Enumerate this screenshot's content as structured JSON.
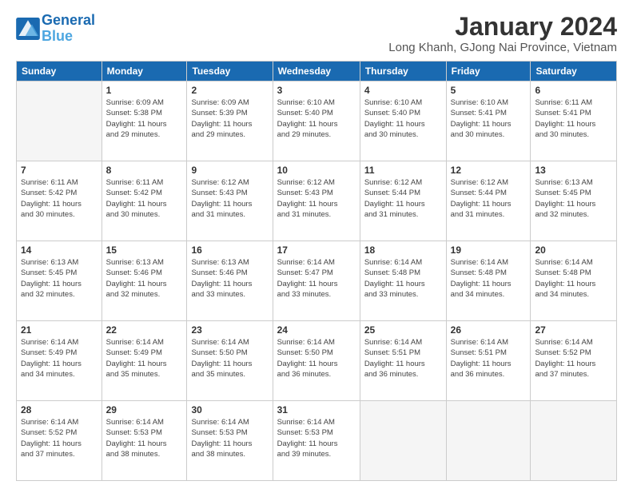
{
  "logo": {
    "line1": "General",
    "line2": "Blue"
  },
  "title": "January 2024",
  "location": "Long Khanh, GJong Nai Province, Vietnam",
  "headers": [
    "Sunday",
    "Monday",
    "Tuesday",
    "Wednesday",
    "Thursday",
    "Friday",
    "Saturday"
  ],
  "weeks": [
    [
      {
        "day": "",
        "info": ""
      },
      {
        "day": "1",
        "info": "Sunrise: 6:09 AM\nSunset: 5:38 PM\nDaylight: 11 hours\nand 29 minutes."
      },
      {
        "day": "2",
        "info": "Sunrise: 6:09 AM\nSunset: 5:39 PM\nDaylight: 11 hours\nand 29 minutes."
      },
      {
        "day": "3",
        "info": "Sunrise: 6:10 AM\nSunset: 5:40 PM\nDaylight: 11 hours\nand 29 minutes."
      },
      {
        "day": "4",
        "info": "Sunrise: 6:10 AM\nSunset: 5:40 PM\nDaylight: 11 hours\nand 30 minutes."
      },
      {
        "day": "5",
        "info": "Sunrise: 6:10 AM\nSunset: 5:41 PM\nDaylight: 11 hours\nand 30 minutes."
      },
      {
        "day": "6",
        "info": "Sunrise: 6:11 AM\nSunset: 5:41 PM\nDaylight: 11 hours\nand 30 minutes."
      }
    ],
    [
      {
        "day": "7",
        "info": "Sunrise: 6:11 AM\nSunset: 5:42 PM\nDaylight: 11 hours\nand 30 minutes."
      },
      {
        "day": "8",
        "info": "Sunrise: 6:11 AM\nSunset: 5:42 PM\nDaylight: 11 hours\nand 30 minutes."
      },
      {
        "day": "9",
        "info": "Sunrise: 6:12 AM\nSunset: 5:43 PM\nDaylight: 11 hours\nand 31 minutes."
      },
      {
        "day": "10",
        "info": "Sunrise: 6:12 AM\nSunset: 5:43 PM\nDaylight: 11 hours\nand 31 minutes."
      },
      {
        "day": "11",
        "info": "Sunrise: 6:12 AM\nSunset: 5:44 PM\nDaylight: 11 hours\nand 31 minutes."
      },
      {
        "day": "12",
        "info": "Sunrise: 6:12 AM\nSunset: 5:44 PM\nDaylight: 11 hours\nand 31 minutes."
      },
      {
        "day": "13",
        "info": "Sunrise: 6:13 AM\nSunset: 5:45 PM\nDaylight: 11 hours\nand 32 minutes."
      }
    ],
    [
      {
        "day": "14",
        "info": "Sunrise: 6:13 AM\nSunset: 5:45 PM\nDaylight: 11 hours\nand 32 minutes."
      },
      {
        "day": "15",
        "info": "Sunrise: 6:13 AM\nSunset: 5:46 PM\nDaylight: 11 hours\nand 32 minutes."
      },
      {
        "day": "16",
        "info": "Sunrise: 6:13 AM\nSunset: 5:46 PM\nDaylight: 11 hours\nand 33 minutes."
      },
      {
        "day": "17",
        "info": "Sunrise: 6:14 AM\nSunset: 5:47 PM\nDaylight: 11 hours\nand 33 minutes."
      },
      {
        "day": "18",
        "info": "Sunrise: 6:14 AM\nSunset: 5:48 PM\nDaylight: 11 hours\nand 33 minutes."
      },
      {
        "day": "19",
        "info": "Sunrise: 6:14 AM\nSunset: 5:48 PM\nDaylight: 11 hours\nand 34 minutes."
      },
      {
        "day": "20",
        "info": "Sunrise: 6:14 AM\nSunset: 5:48 PM\nDaylight: 11 hours\nand 34 minutes."
      }
    ],
    [
      {
        "day": "21",
        "info": "Sunrise: 6:14 AM\nSunset: 5:49 PM\nDaylight: 11 hours\nand 34 minutes."
      },
      {
        "day": "22",
        "info": "Sunrise: 6:14 AM\nSunset: 5:49 PM\nDaylight: 11 hours\nand 35 minutes."
      },
      {
        "day": "23",
        "info": "Sunrise: 6:14 AM\nSunset: 5:50 PM\nDaylight: 11 hours\nand 35 minutes."
      },
      {
        "day": "24",
        "info": "Sunrise: 6:14 AM\nSunset: 5:50 PM\nDaylight: 11 hours\nand 36 minutes."
      },
      {
        "day": "25",
        "info": "Sunrise: 6:14 AM\nSunset: 5:51 PM\nDaylight: 11 hours\nand 36 minutes."
      },
      {
        "day": "26",
        "info": "Sunrise: 6:14 AM\nSunset: 5:51 PM\nDaylight: 11 hours\nand 36 minutes."
      },
      {
        "day": "27",
        "info": "Sunrise: 6:14 AM\nSunset: 5:52 PM\nDaylight: 11 hours\nand 37 minutes."
      }
    ],
    [
      {
        "day": "28",
        "info": "Sunrise: 6:14 AM\nSunset: 5:52 PM\nDaylight: 11 hours\nand 37 minutes."
      },
      {
        "day": "29",
        "info": "Sunrise: 6:14 AM\nSunset: 5:53 PM\nDaylight: 11 hours\nand 38 minutes."
      },
      {
        "day": "30",
        "info": "Sunrise: 6:14 AM\nSunset: 5:53 PM\nDaylight: 11 hours\nand 38 minutes."
      },
      {
        "day": "31",
        "info": "Sunrise: 6:14 AM\nSunset: 5:53 PM\nDaylight: 11 hours\nand 39 minutes."
      },
      {
        "day": "",
        "info": ""
      },
      {
        "day": "",
        "info": ""
      },
      {
        "day": "",
        "info": ""
      }
    ]
  ]
}
